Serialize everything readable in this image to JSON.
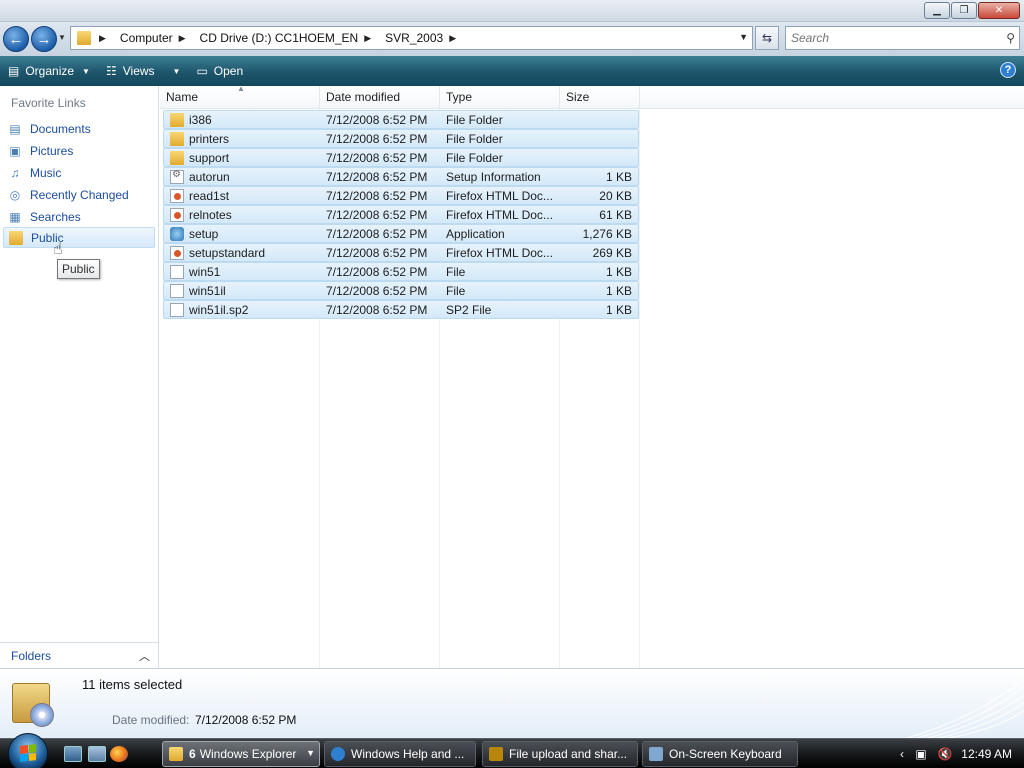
{
  "window": {
    "minimize": "▁",
    "maximize": "❐",
    "close": "✕"
  },
  "address": {
    "crumbs": [
      "Computer",
      "CD Drive (D:) CC1HOEM_EN",
      "SVR_2003"
    ],
    "search_placeholder": "Search"
  },
  "toolbar": {
    "organize": "Organize",
    "views": "Views",
    "open": "Open",
    "help": "?"
  },
  "sidebar": {
    "title": "Favorite Links",
    "items": [
      {
        "label": "Documents",
        "icon": "documents-icon"
      },
      {
        "label": "Pictures",
        "icon": "pictures-icon"
      },
      {
        "label": "Music",
        "icon": "music-icon"
      },
      {
        "label": "Recently Changed",
        "icon": "recently-changed-icon"
      },
      {
        "label": "Searches",
        "icon": "searches-icon"
      },
      {
        "label": "Public",
        "icon": "folder-icon"
      }
    ],
    "tooltip": "Public",
    "folders_label": "Folders"
  },
  "columns": {
    "name": "Name",
    "date": "Date modified",
    "type": "Type",
    "size": "Size"
  },
  "files": [
    {
      "name": "i386",
      "date": "7/12/2008 6:52 PM",
      "type": "File Folder",
      "size": "",
      "icon": "folder"
    },
    {
      "name": "printers",
      "date": "7/12/2008 6:52 PM",
      "type": "File Folder",
      "size": "",
      "icon": "folder"
    },
    {
      "name": "support",
      "date": "7/12/2008 6:52 PM",
      "type": "File Folder",
      "size": "",
      "icon": "folder"
    },
    {
      "name": "autorun",
      "date": "7/12/2008 6:52 PM",
      "type": "Setup Information",
      "size": "1 KB",
      "icon": "setupinfo"
    },
    {
      "name": "read1st",
      "date": "7/12/2008 6:52 PM",
      "type": "Firefox HTML Doc...",
      "size": "20 KB",
      "icon": "html"
    },
    {
      "name": "relnotes",
      "date": "7/12/2008 6:52 PM",
      "type": "Firefox HTML Doc...",
      "size": "61 KB",
      "icon": "html"
    },
    {
      "name": "setup",
      "date": "7/12/2008 6:52 PM",
      "type": "Application",
      "size": "1,276 KB",
      "icon": "app"
    },
    {
      "name": "setupstandard",
      "date": "7/12/2008 6:52 PM",
      "type": "Firefox HTML Doc...",
      "size": "269 KB",
      "icon": "html"
    },
    {
      "name": "win51",
      "date": "7/12/2008 6:52 PM",
      "type": "File",
      "size": "1 KB",
      "icon": "file"
    },
    {
      "name": "win51il",
      "date": "7/12/2008 6:52 PM",
      "type": "File",
      "size": "1 KB",
      "icon": "file"
    },
    {
      "name": "win51il.sp2",
      "date": "7/12/2008 6:52 PM",
      "type": "SP2 File",
      "size": "1 KB",
      "icon": "file"
    }
  ],
  "details": {
    "items_selected": "11 items selected",
    "date_label": "Date modified:",
    "date_value": "7/12/2008 6:52 PM"
  },
  "taskbar": {
    "tasks": [
      {
        "count": "6",
        "label": "Windows Explorer"
      },
      {
        "count": "",
        "label": "Windows Help and ..."
      },
      {
        "count": "",
        "label": "File upload and shar..."
      },
      {
        "count": "",
        "label": "On-Screen Keyboard"
      }
    ],
    "clock": "12:49 AM"
  },
  "colors": {
    "toolbar": "#1d556b",
    "link": "#1a4d9c",
    "selection": "#d3e8f8"
  }
}
